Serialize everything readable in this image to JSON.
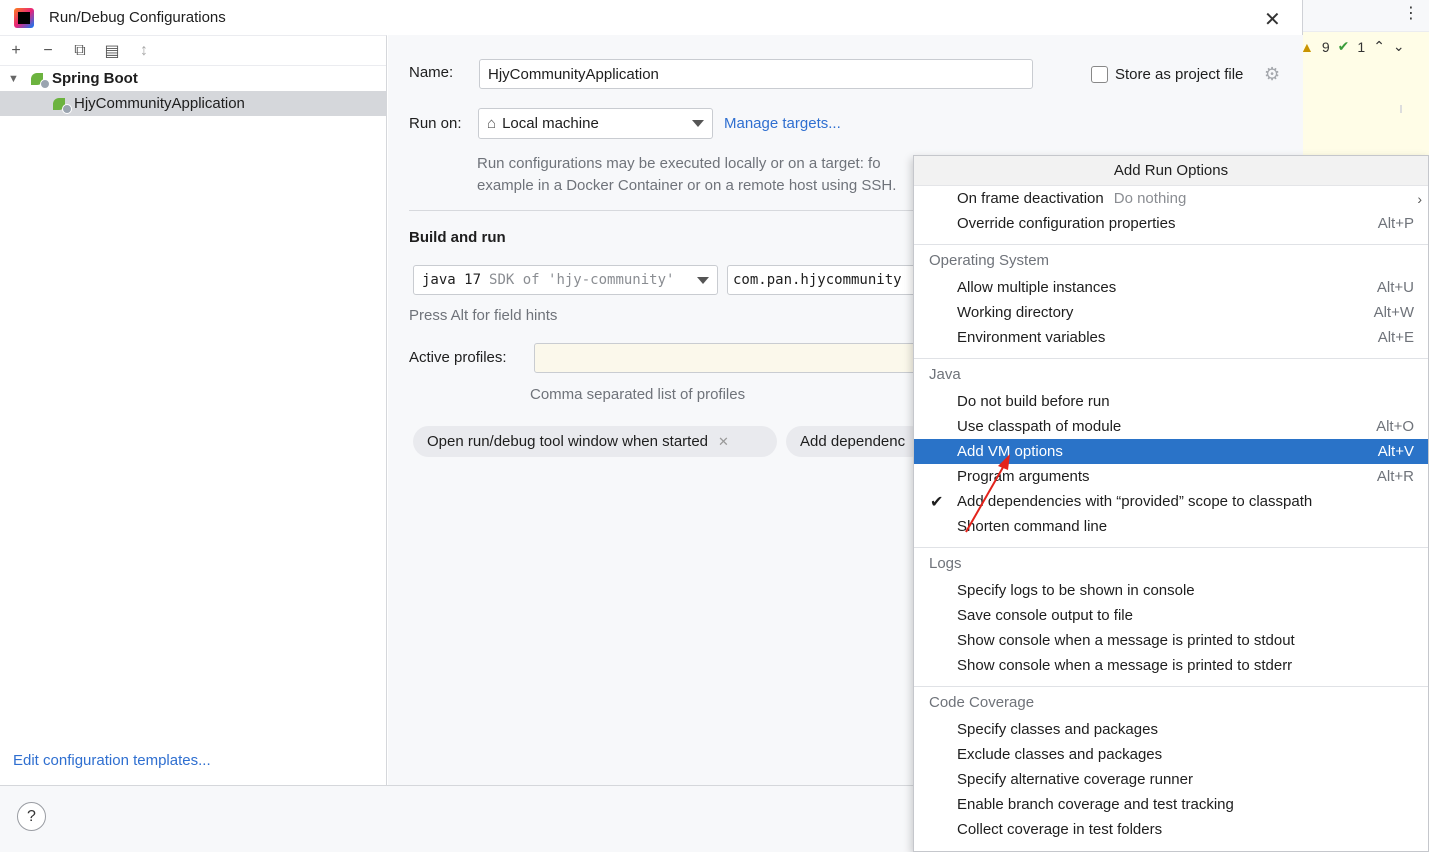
{
  "window": {
    "title": "Run/Debug Configurations"
  },
  "left": {
    "toolbar": [
      "+",
      "−",
      "⧉",
      "▤",
      "↕"
    ],
    "tree": {
      "group": "Spring Boot",
      "item": "HjyCommunityApplication"
    },
    "edit_templates": "Edit configuration templates..."
  },
  "form": {
    "name_label": "Name:",
    "name_value": "HjyCommunityApplication",
    "store_label": "Store as project file",
    "runon_label": "Run on:",
    "runon_value": "Local machine",
    "manage_targets": "Manage targets...",
    "runon_hint_1": "Run configurations may be executed locally or on a target: fo",
    "runon_hint_2": "example in a Docker Container or on a remote host using SSH.",
    "build_run_title": "Build and run",
    "jdk_main": "java 17",
    "jdk_sdk": "SDK of 'hjy-community'",
    "main_class": "com.pan.hjycommunity",
    "field_hints": "Press Alt for field hints",
    "profiles_label": "Active profiles:",
    "profiles_hint": "Comma separated list of profiles",
    "chip_tool": "Open run/debug tool window when started",
    "chip_deps": "Add dependenc"
  },
  "background": {
    "warnings": "9",
    "checks": "1"
  },
  "popup": {
    "title": "Add Run Options",
    "top_items": [
      {
        "label": "On frame deactivation",
        "sub": "Do nothing",
        "shortcut": ""
      },
      {
        "label": "Override configuration properties",
        "sub": "",
        "shortcut": "Alt+P"
      }
    ],
    "sections": [
      {
        "title": "Operating System",
        "items": [
          {
            "label": "Allow multiple instances",
            "shortcut": "Alt+U"
          },
          {
            "label": "Working directory",
            "shortcut": "Alt+W"
          },
          {
            "label": "Environment variables",
            "shortcut": "Alt+E"
          }
        ]
      },
      {
        "title": "Java",
        "items": [
          {
            "label": "Do not build before run",
            "shortcut": ""
          },
          {
            "label": "Use classpath of module",
            "shortcut": "Alt+O"
          },
          {
            "label": "Add VM options",
            "shortcut": "Alt+V",
            "selected": true
          },
          {
            "label": "Program arguments",
            "shortcut": "Alt+R"
          },
          {
            "label": "Add dependencies with “provided” scope to classpath",
            "shortcut": "",
            "checked": true
          },
          {
            "label": "Shorten command line",
            "shortcut": ""
          }
        ]
      },
      {
        "title": "Logs",
        "items": [
          {
            "label": "Specify logs to be shown in console",
            "shortcut": ""
          },
          {
            "label": "Save console output to file",
            "shortcut": ""
          },
          {
            "label": "Show console when a message is printed to stdout",
            "shortcut": ""
          },
          {
            "label": "Show console when a message is printed to stderr",
            "shortcut": ""
          }
        ]
      },
      {
        "title": "Code Coverage",
        "items": [
          {
            "label": "Specify classes and packages",
            "shortcut": ""
          },
          {
            "label": "Exclude classes and packages",
            "shortcut": ""
          },
          {
            "label": "Specify alternative coverage runner",
            "shortcut": ""
          },
          {
            "label": "Enable branch coverage and test tracking",
            "shortcut": ""
          },
          {
            "label": "Collect coverage in test folders",
            "shortcut": ""
          }
        ]
      }
    ]
  },
  "colors": {
    "selection": "#2a73c8",
    "link": "#2f6fd0",
    "annotation_arrow": "#e3231b"
  }
}
